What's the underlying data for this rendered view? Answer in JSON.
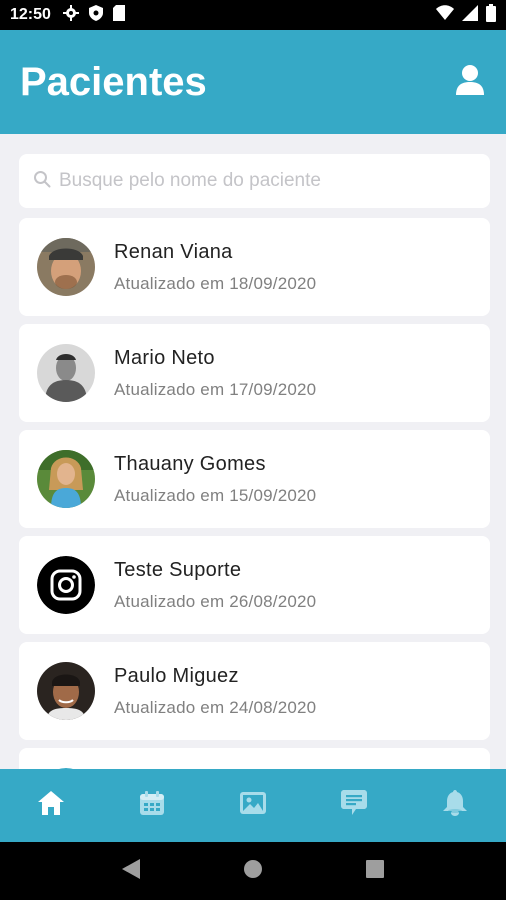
{
  "status_bar": {
    "time": "12:50",
    "icons": [
      "gear-icon",
      "shield-icon",
      "sd-card-icon",
      "wifi-icon",
      "signal-icon",
      "battery-icon"
    ]
  },
  "header": {
    "title": "Pacientes",
    "profile_icon": "user-icon"
  },
  "search": {
    "placeholder": "Busque pelo nome do paciente",
    "value": ""
  },
  "patients": [
    {
      "name": "Renan Viana",
      "updated": "Atualizado em 18/09/2020",
      "avatar": "photo"
    },
    {
      "name": "Mario Neto",
      "updated": "Atualizado em 17/09/2020",
      "avatar": "photo"
    },
    {
      "name": "Thauany Gomes",
      "updated": "Atualizado em 15/09/2020",
      "avatar": "photo"
    },
    {
      "name": "Teste Suporte",
      "updated": "Atualizado em 26/08/2020",
      "avatar": "instagram-logo"
    },
    {
      "name": "Paulo Miguez",
      "updated": "Atualizado em 24/08/2020",
      "avatar": "photo"
    }
  ],
  "bottom_nav": {
    "items": [
      "home-icon",
      "calendar-icon",
      "image-icon",
      "chat-icon",
      "bell-icon"
    ],
    "active": "home-icon"
  },
  "colors": {
    "primary": "#36a9c6",
    "background": "#f0f0f4",
    "card": "#ffffff",
    "text_primary": "#222222",
    "text_secondary": "#808080"
  }
}
